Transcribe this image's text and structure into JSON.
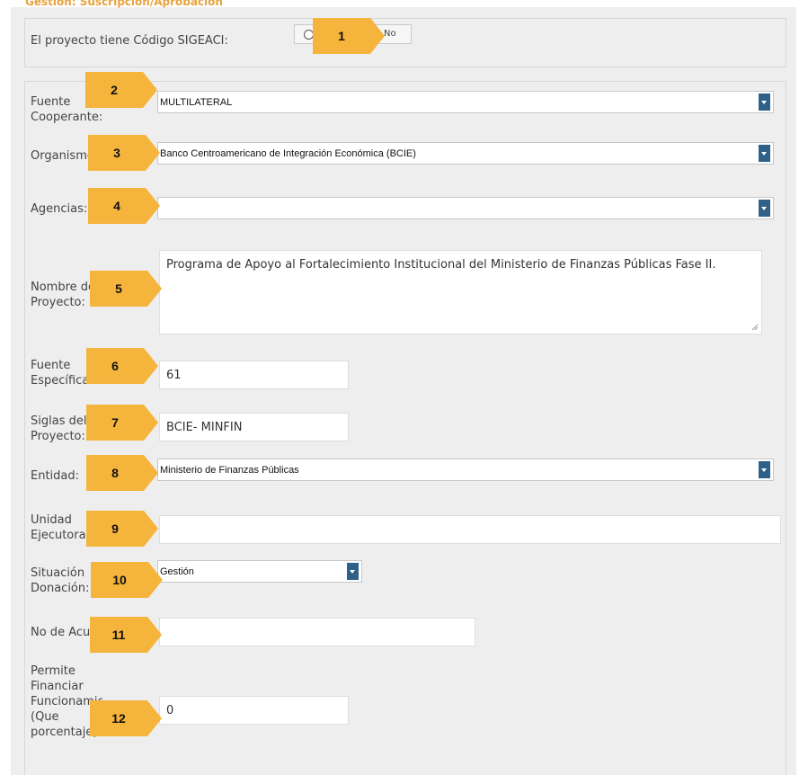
{
  "section_title_cut": "Gestión: Suscripción/Aprobación",
  "sigeaci": {
    "question": "El proyecto tiene Código SIGEACI:",
    "option_no": "No",
    "selected": "No"
  },
  "fields": {
    "fuente_cooperante": {
      "label": "Fuente\nCooperante:",
      "value": "MULTILATERAL"
    },
    "organismo": {
      "label": "Organismo:",
      "value": "Banco Centroamericano de Integración Económica (BCIE)"
    },
    "agencias": {
      "label": "Agencias:",
      "value": ""
    },
    "nombre_proyecto": {
      "label": "Nombre del\nProyecto:",
      "value": "Programa de Apoyo al Fortalecimiento Institucional del Ministerio de Finanzas Públicas Fase II."
    },
    "fuente_especifica": {
      "label": "Fuente\nEspecífica:",
      "value": "61"
    },
    "siglas_proyecto": {
      "label": "Siglas del\nProyecto:",
      "value": "BCIE- MINFIN"
    },
    "entidad": {
      "label": "Entidad:",
      "value": "Ministerio de Finanzas Públicas"
    },
    "unidad_ejecutora": {
      "label": "Unidad\nEjecutora:",
      "value": ""
    },
    "situacion_donacion": {
      "label": "Situación\nDonación:",
      "value": "Gestión"
    },
    "no_acuerdo": {
      "label": "No de Acuerdo:",
      "value": ""
    },
    "permite_financiar": {
      "label": "Permite\nFinanciar\nFuncionamiento\n(Que\nporcentaje):",
      "value": "0"
    }
  },
  "callouts": [
    "1",
    "2",
    "3",
    "4",
    "5",
    "6",
    "7",
    "8",
    "9",
    "10",
    "11",
    "12"
  ],
  "colors": {
    "callout": "#f5b43b",
    "dropdown_button": "#2e6088",
    "panel_bg": "#eeeeee",
    "title_orange": "#e8a33d"
  }
}
